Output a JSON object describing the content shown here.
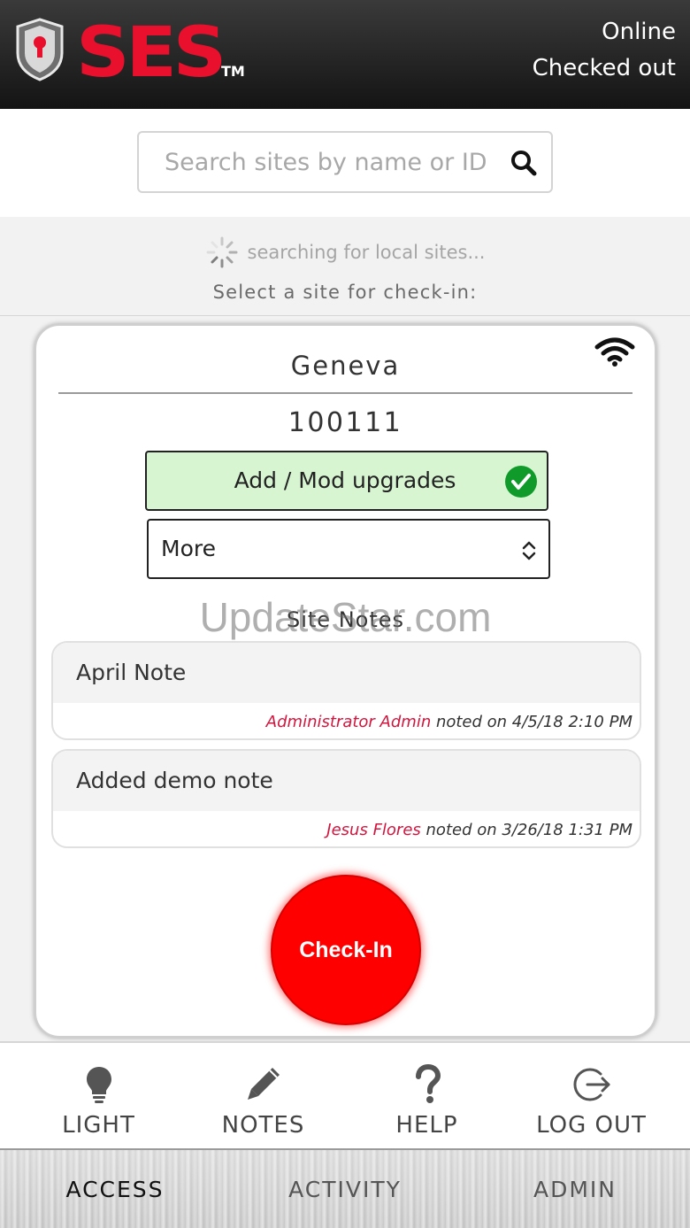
{
  "header": {
    "logo_text": "SES",
    "trademark": "TM",
    "status_line1": "Online",
    "status_line2": "Checked out"
  },
  "search": {
    "placeholder": "Search sites by name or ID",
    "value": ""
  },
  "searching_text": "searching for local sites...",
  "select_prompt": "Select a site for check-in:",
  "site": {
    "name": "Geneva",
    "id": "100111",
    "upgrade_label": "Add / Mod upgrades",
    "more_label": "More",
    "notes_title": "Site Notes",
    "notes": [
      {
        "text": "April Note",
        "author": "Administrator Admin",
        "meta": " noted on 4/5/18 2:10 PM"
      },
      {
        "text": "Added demo note",
        "author": "Jesus Flores",
        "meta": " noted on 3/26/18 1:31 PM"
      }
    ],
    "checkin_label": "Check-In"
  },
  "watermark": "UpdateStar.com",
  "toolbar": {
    "light": "LIGHT",
    "notes": "NOTES",
    "help": "HELP",
    "logout": "LOG OUT"
  },
  "tabs": {
    "access": "ACCESS",
    "activity": "ACTIVITY",
    "admin": "ADMIN"
  },
  "colors": {
    "brand_red": "#e8102c",
    "checkin_red": "#ff0000",
    "note_author": "#d3143d",
    "upgrade_bg": "#d8f5d2",
    "check_green": "#109a2a"
  }
}
